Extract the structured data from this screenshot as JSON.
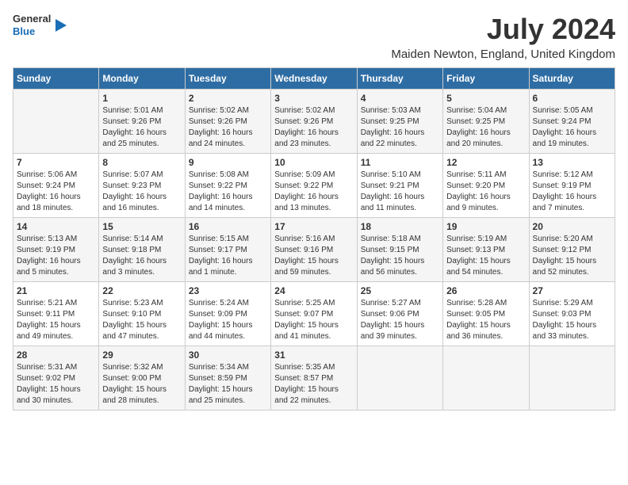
{
  "logo": {
    "general": "General",
    "blue": "Blue"
  },
  "header": {
    "month": "July 2024",
    "location": "Maiden Newton, England, United Kingdom"
  },
  "weekdays": [
    "Sunday",
    "Monday",
    "Tuesday",
    "Wednesday",
    "Thursday",
    "Friday",
    "Saturday"
  ],
  "weeks": [
    [
      {
        "day": "",
        "sunrise": "",
        "sunset": "",
        "daylight": ""
      },
      {
        "day": "1",
        "sunrise": "Sunrise: 5:01 AM",
        "sunset": "Sunset: 9:26 PM",
        "daylight": "Daylight: 16 hours and 25 minutes."
      },
      {
        "day": "2",
        "sunrise": "Sunrise: 5:02 AM",
        "sunset": "Sunset: 9:26 PM",
        "daylight": "Daylight: 16 hours and 24 minutes."
      },
      {
        "day": "3",
        "sunrise": "Sunrise: 5:02 AM",
        "sunset": "Sunset: 9:26 PM",
        "daylight": "Daylight: 16 hours and 23 minutes."
      },
      {
        "day": "4",
        "sunrise": "Sunrise: 5:03 AM",
        "sunset": "Sunset: 9:25 PM",
        "daylight": "Daylight: 16 hours and 22 minutes."
      },
      {
        "day": "5",
        "sunrise": "Sunrise: 5:04 AM",
        "sunset": "Sunset: 9:25 PM",
        "daylight": "Daylight: 16 hours and 20 minutes."
      },
      {
        "day": "6",
        "sunrise": "Sunrise: 5:05 AM",
        "sunset": "Sunset: 9:24 PM",
        "daylight": "Daylight: 16 hours and 19 minutes."
      }
    ],
    [
      {
        "day": "7",
        "sunrise": "Sunrise: 5:06 AM",
        "sunset": "Sunset: 9:24 PM",
        "daylight": "Daylight: 16 hours and 18 minutes."
      },
      {
        "day": "8",
        "sunrise": "Sunrise: 5:07 AM",
        "sunset": "Sunset: 9:23 PM",
        "daylight": "Daylight: 16 hours and 16 minutes."
      },
      {
        "day": "9",
        "sunrise": "Sunrise: 5:08 AM",
        "sunset": "Sunset: 9:22 PM",
        "daylight": "Daylight: 16 hours and 14 minutes."
      },
      {
        "day": "10",
        "sunrise": "Sunrise: 5:09 AM",
        "sunset": "Sunset: 9:22 PM",
        "daylight": "Daylight: 16 hours and 13 minutes."
      },
      {
        "day": "11",
        "sunrise": "Sunrise: 5:10 AM",
        "sunset": "Sunset: 9:21 PM",
        "daylight": "Daylight: 16 hours and 11 minutes."
      },
      {
        "day": "12",
        "sunrise": "Sunrise: 5:11 AM",
        "sunset": "Sunset: 9:20 PM",
        "daylight": "Daylight: 16 hours and 9 minutes."
      },
      {
        "day": "13",
        "sunrise": "Sunrise: 5:12 AM",
        "sunset": "Sunset: 9:19 PM",
        "daylight": "Daylight: 16 hours and 7 minutes."
      }
    ],
    [
      {
        "day": "14",
        "sunrise": "Sunrise: 5:13 AM",
        "sunset": "Sunset: 9:19 PM",
        "daylight": "Daylight: 16 hours and 5 minutes."
      },
      {
        "day": "15",
        "sunrise": "Sunrise: 5:14 AM",
        "sunset": "Sunset: 9:18 PM",
        "daylight": "Daylight: 16 hours and 3 minutes."
      },
      {
        "day": "16",
        "sunrise": "Sunrise: 5:15 AM",
        "sunset": "Sunset: 9:17 PM",
        "daylight": "Daylight: 16 hours and 1 minute."
      },
      {
        "day": "17",
        "sunrise": "Sunrise: 5:16 AM",
        "sunset": "Sunset: 9:16 PM",
        "daylight": "Daylight: 15 hours and 59 minutes."
      },
      {
        "day": "18",
        "sunrise": "Sunrise: 5:18 AM",
        "sunset": "Sunset: 9:15 PM",
        "daylight": "Daylight: 15 hours and 56 minutes."
      },
      {
        "day": "19",
        "sunrise": "Sunrise: 5:19 AM",
        "sunset": "Sunset: 9:13 PM",
        "daylight": "Daylight: 15 hours and 54 minutes."
      },
      {
        "day": "20",
        "sunrise": "Sunrise: 5:20 AM",
        "sunset": "Sunset: 9:12 PM",
        "daylight": "Daylight: 15 hours and 52 minutes."
      }
    ],
    [
      {
        "day": "21",
        "sunrise": "Sunrise: 5:21 AM",
        "sunset": "Sunset: 9:11 PM",
        "daylight": "Daylight: 15 hours and 49 minutes."
      },
      {
        "day": "22",
        "sunrise": "Sunrise: 5:23 AM",
        "sunset": "Sunset: 9:10 PM",
        "daylight": "Daylight: 15 hours and 47 minutes."
      },
      {
        "day": "23",
        "sunrise": "Sunrise: 5:24 AM",
        "sunset": "Sunset: 9:09 PM",
        "daylight": "Daylight: 15 hours and 44 minutes."
      },
      {
        "day": "24",
        "sunrise": "Sunrise: 5:25 AM",
        "sunset": "Sunset: 9:07 PM",
        "daylight": "Daylight: 15 hours and 41 minutes."
      },
      {
        "day": "25",
        "sunrise": "Sunrise: 5:27 AM",
        "sunset": "Sunset: 9:06 PM",
        "daylight": "Daylight: 15 hours and 39 minutes."
      },
      {
        "day": "26",
        "sunrise": "Sunrise: 5:28 AM",
        "sunset": "Sunset: 9:05 PM",
        "daylight": "Daylight: 15 hours and 36 minutes."
      },
      {
        "day": "27",
        "sunrise": "Sunrise: 5:29 AM",
        "sunset": "Sunset: 9:03 PM",
        "daylight": "Daylight: 15 hours and 33 minutes."
      }
    ],
    [
      {
        "day": "28",
        "sunrise": "Sunrise: 5:31 AM",
        "sunset": "Sunset: 9:02 PM",
        "daylight": "Daylight: 15 hours and 30 minutes."
      },
      {
        "day": "29",
        "sunrise": "Sunrise: 5:32 AM",
        "sunset": "Sunset: 9:00 PM",
        "daylight": "Daylight: 15 hours and 28 minutes."
      },
      {
        "day": "30",
        "sunrise": "Sunrise: 5:34 AM",
        "sunset": "Sunset: 8:59 PM",
        "daylight": "Daylight: 15 hours and 25 minutes."
      },
      {
        "day": "31",
        "sunrise": "Sunrise: 5:35 AM",
        "sunset": "Sunset: 8:57 PM",
        "daylight": "Daylight: 15 hours and 22 minutes."
      },
      {
        "day": "",
        "sunrise": "",
        "sunset": "",
        "daylight": ""
      },
      {
        "day": "",
        "sunrise": "",
        "sunset": "",
        "daylight": ""
      },
      {
        "day": "",
        "sunrise": "",
        "sunset": "",
        "daylight": ""
      }
    ]
  ]
}
